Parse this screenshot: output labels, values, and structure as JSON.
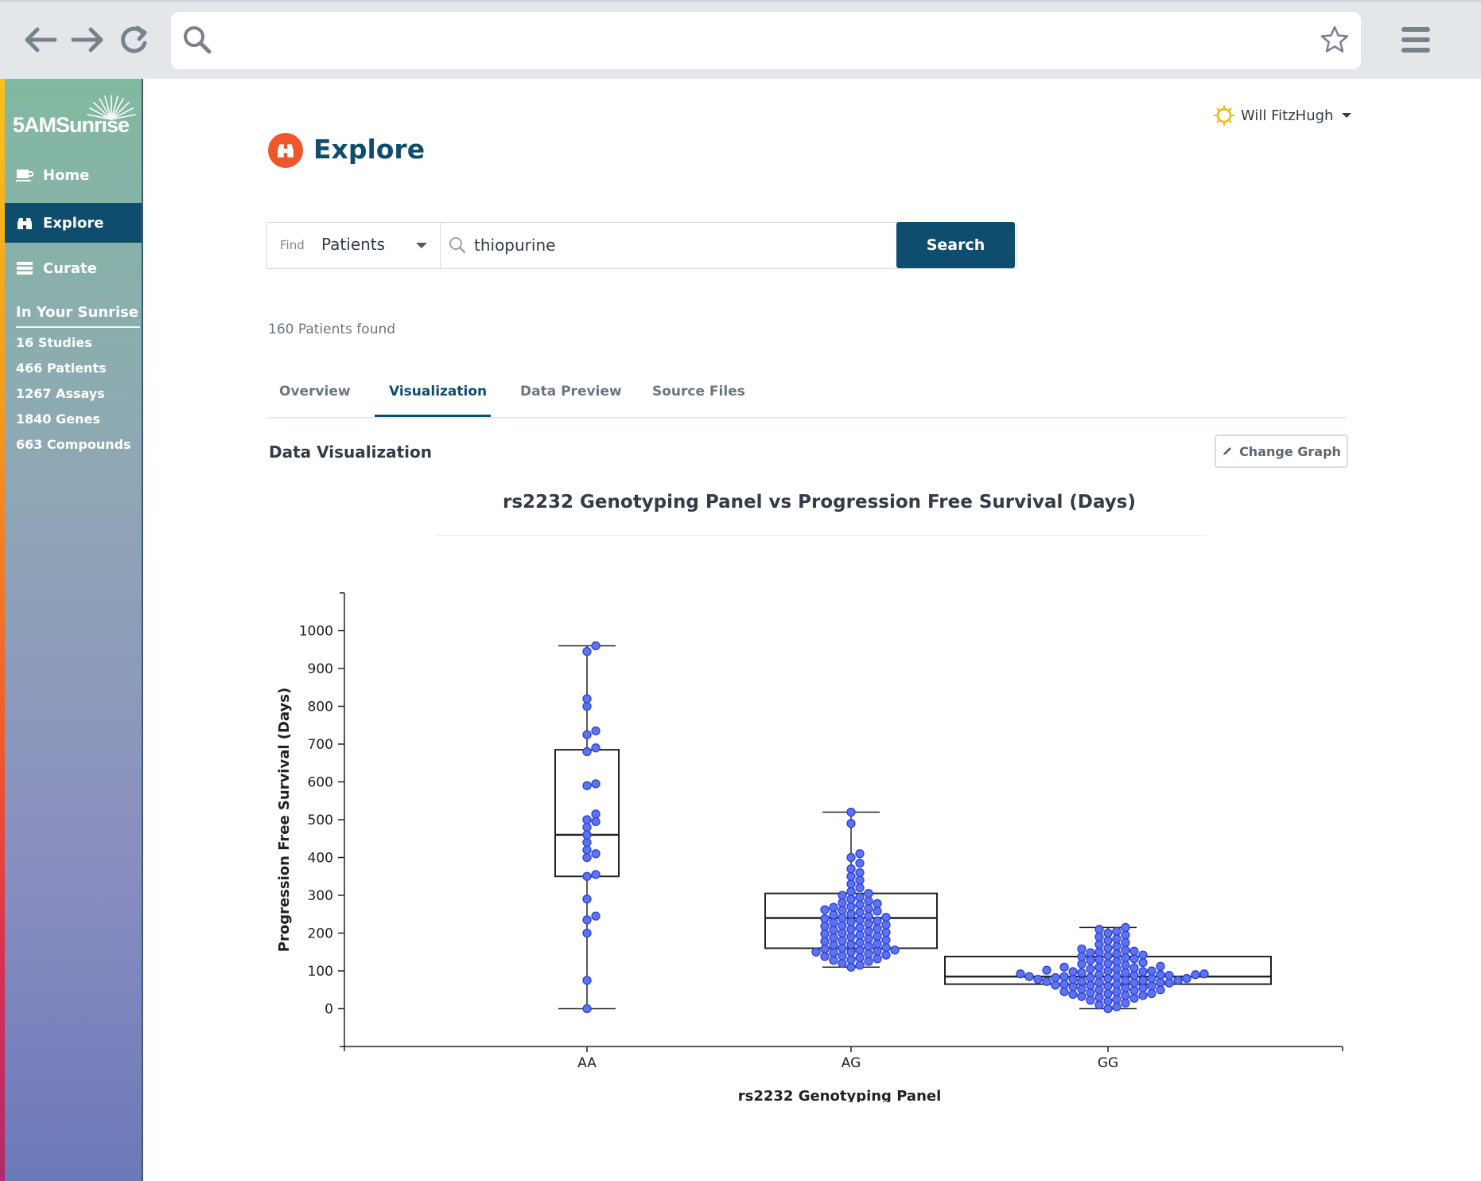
{
  "browser": {
    "address": ""
  },
  "sidebar": {
    "brand": "5AMSunrise",
    "nav": [
      {
        "label": "Home",
        "icon": "cup-icon"
      },
      {
        "label": "Explore",
        "icon": "binoculars-icon",
        "active": true
      },
      {
        "label": "Curate",
        "icon": "stack-icon"
      }
    ],
    "section_title": "In Your Sunrise",
    "stats": [
      "16 Studies",
      "466 Patients",
      "1267 Assays",
      "1840 Genes",
      "663 Compounds"
    ]
  },
  "header": {
    "user_name": "Will FitzHugh",
    "page_title": "Explore"
  },
  "search": {
    "find_label": "Find",
    "find_value": "Patients",
    "query": "thiopurine",
    "button_label": "Search"
  },
  "results": {
    "count_text": "160 Patients found"
  },
  "tabs": [
    {
      "label": "Overview"
    },
    {
      "label": "Visualization",
      "active": true
    },
    {
      "label": "Data Preview"
    },
    {
      "label": "Source Files"
    }
  ],
  "visualization": {
    "section_title": "Data Visualization",
    "change_graph_label": "Change Graph"
  },
  "colors": {
    "primary": "#0f4d6e",
    "accent": "#f0562b",
    "point_fill": "#5b73f5",
    "point_stroke": "#2f3fd0"
  },
  "chart_data": {
    "type": "box",
    "title": "rs2232 Genotyping Panel vs Progression Free Survival (Days)",
    "xlabel": "rs2232 Genotyping Panel",
    "ylabel": "Progression Free Survival (Days)",
    "ylim": [
      -100,
      1100
    ],
    "yticks": [
      0,
      100,
      200,
      300,
      400,
      500,
      600,
      700,
      800,
      900,
      1000
    ],
    "categories": [
      "AA",
      "AG",
      "GG"
    ],
    "boxes": [
      {
        "category": "AA",
        "min": 0,
        "q1": 350,
        "median": 460,
        "q3": 685,
        "max": 960
      },
      {
        "category": "AG",
        "min": 110,
        "q1": 160,
        "median": 240,
        "q3": 305,
        "max": 520
      },
      {
        "category": "GG",
        "min": 0,
        "q1": 65,
        "median": 85,
        "q3": 138,
        "max": 215
      }
    ],
    "points": {
      "AA": [
        0,
        75,
        200,
        235,
        245,
        290,
        350,
        355,
        400,
        410,
        420,
        440,
        460,
        480,
        495,
        500,
        515,
        590,
        595,
        680,
        690,
        725,
        735,
        800,
        820,
        945,
        960
      ],
      "AG": [
        110,
        115,
        120,
        125,
        128,
        130,
        132,
        135,
        138,
        140,
        142,
        145,
        148,
        150,
        150,
        152,
        155,
        155,
        158,
        160,
        162,
        165,
        168,
        170,
        172,
        175,
        178,
        180,
        182,
        185,
        188,
        190,
        192,
        195,
        198,
        200,
        202,
        205,
        208,
        210,
        212,
        215,
        218,
        220,
        222,
        225,
        228,
        230,
        232,
        235,
        238,
        240,
        242,
        245,
        248,
        250,
        255,
        258,
        260,
        262,
        265,
        268,
        270,
        275,
        278,
        280,
        285,
        290,
        295,
        300,
        305,
        310,
        320,
        330,
        340,
        350,
        360,
        370,
        385,
        400,
        410,
        490,
        520
      ],
      "GG": [
        0,
        5,
        10,
        15,
        20,
        22,
        25,
        28,
        30,
        32,
        35,
        35,
        38,
        40,
        40,
        42,
        45,
        45,
        48,
        50,
        50,
        52,
        55,
        55,
        58,
        60,
        60,
        62,
        62,
        65,
        65,
        68,
        68,
        70,
        70,
        72,
        72,
        75,
        75,
        75,
        78,
        78,
        80,
        80,
        80,
        82,
        82,
        85,
        85,
        85,
        88,
        88,
        90,
        90,
        90,
        92,
        92,
        95,
        95,
        98,
        98,
        100,
        100,
        102,
        105,
        105,
        108,
        110,
        110,
        112,
        115,
        118,
        120,
        122,
        125,
        128,
        130,
        132,
        135,
        138,
        140,
        142,
        145,
        148,
        150,
        152,
        155,
        158,
        160,
        165,
        170,
        175,
        180,
        185,
        190,
        195,
        200,
        205,
        210,
        215
      ]
    }
  }
}
